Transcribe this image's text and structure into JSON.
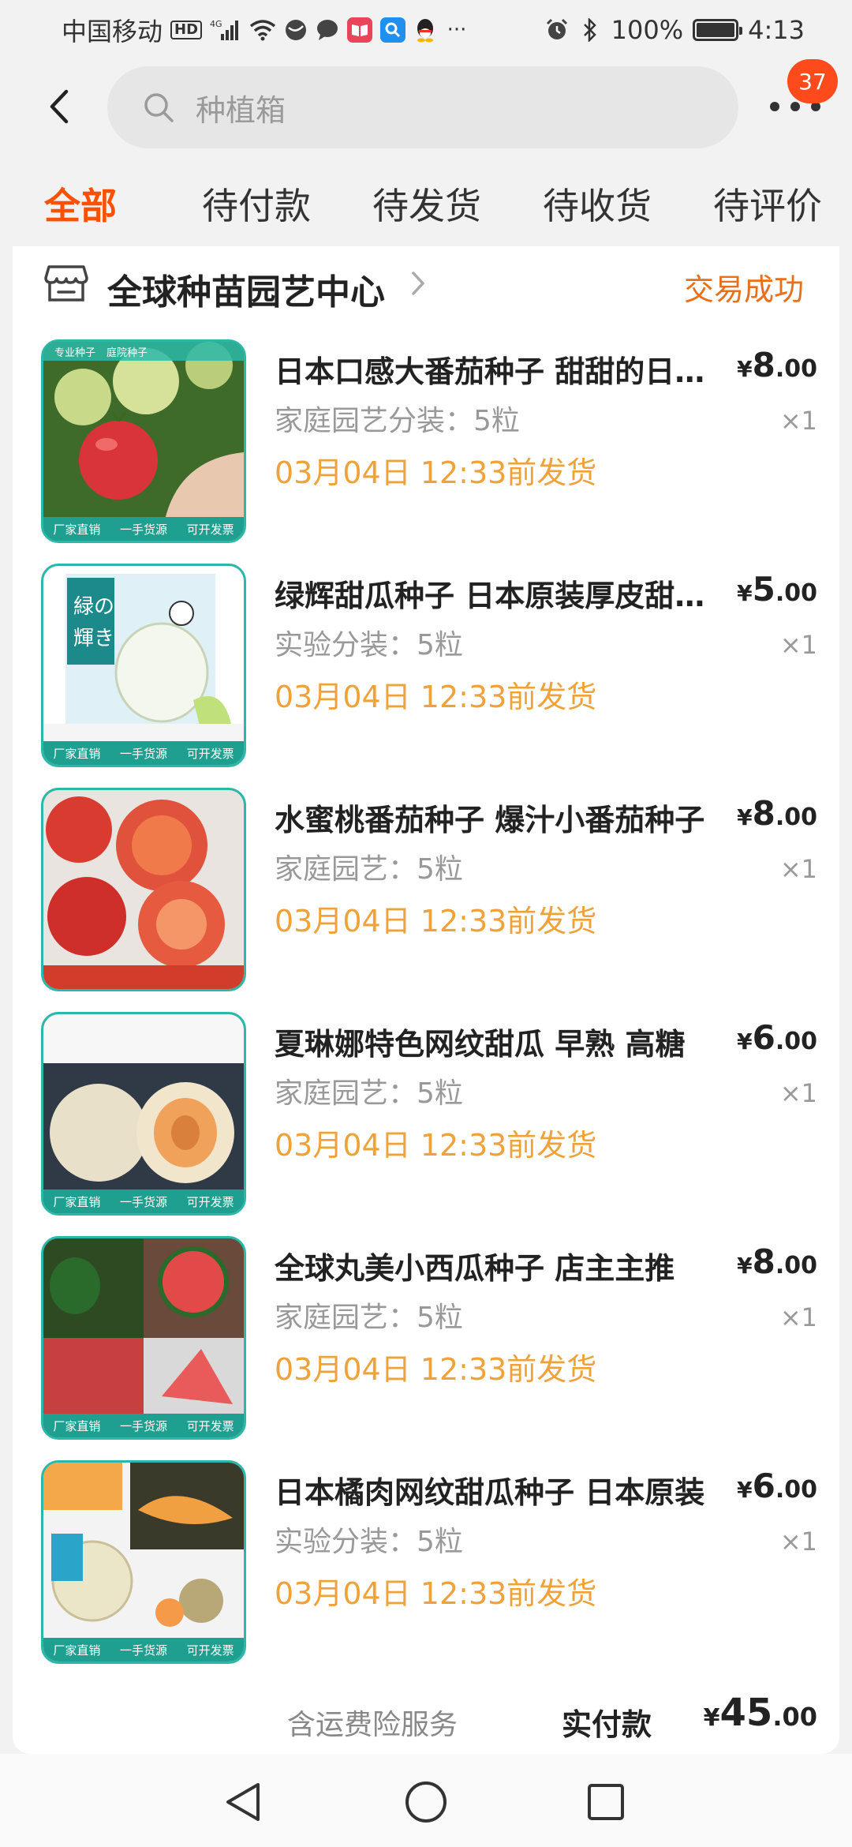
{
  "status_bar": {
    "carrier": "中国移动",
    "hd": "HD",
    "network": "4G",
    "battery": "100%",
    "time": "4:13",
    "icons": [
      "signal-icon",
      "wifi-icon",
      "app-icon",
      "chat-icon",
      "book-icon",
      "search-app-icon",
      "qq-icon",
      "more-dots-icon",
      "alarm-icon",
      "bluetooth-icon",
      "battery-icon"
    ]
  },
  "header": {
    "search_placeholder": "种植箱",
    "notification_count": "37"
  },
  "tabs": [
    "全部",
    "待付款",
    "待发货",
    "待收货",
    "待评价"
  ],
  "active_tab": 0,
  "order": {
    "store_name": "全球种苗园艺中心",
    "status": "交易成功",
    "items": [
      {
        "title": "日本口感大番茄种子  甜甜的日本大番茄",
        "sku": "家庭园艺分装：5粒",
        "ship": "03月04日 12:33前发货",
        "price_currency": "¥",
        "price_int": "8",
        "price_dec": ".00",
        "qty": "×1"
      },
      {
        "title": "绿辉甜瓜种子  日本原装厚皮甜瓜种子",
        "sku": "实验分装：5粒",
        "ship": "03月04日 12:33前发货",
        "price_currency": "¥",
        "price_int": "5",
        "price_dec": ".00",
        "qty": "×1"
      },
      {
        "title": "水蜜桃番茄种子 爆汁小番茄种子",
        "sku": "家庭园艺：5粒",
        "ship": "03月04日 12:33前发货",
        "price_currency": "¥",
        "price_int": "8",
        "price_dec": ".00",
        "qty": "×1"
      },
      {
        "title": "夏琳娜特色网纹甜瓜 早熟 高糖",
        "sku": "家庭园艺：5粒",
        "ship": "03月04日 12:33前发货",
        "price_currency": "¥",
        "price_int": "6",
        "price_dec": ".00",
        "qty": "×1"
      },
      {
        "title": "全球丸美小西瓜种子 店主主推",
        "sku": "家庭园艺：5粒",
        "ship": "03月04日 12:33前发货",
        "price_currency": "¥",
        "price_int": "8",
        "price_dec": ".00",
        "qty": "×1"
      },
      {
        "title": "日本橘肉网纹甜瓜种子 日本原装",
        "sku": "实验分装：5粒",
        "ship": "03月04日 12:33前发货",
        "price_currency": "¥",
        "price_int": "6",
        "price_dec": ".00",
        "qty": "×1"
      }
    ],
    "thumb_tags": [
      "专业种子",
      "庭院种子"
    ],
    "thumb_band": [
      "厂家直销",
      "一手货源",
      "可开发票"
    ],
    "total_note": "含运费险服务",
    "total_label": "实付款",
    "total_currency": "¥",
    "total_int": "45",
    "total_dec": ".00"
  },
  "colors": {
    "accent": "#ff5000",
    "status_orange": "#e8701a",
    "ship_orange": "#f0a23a",
    "badge_red": "#ff4a1c",
    "thumb_teal": "#2bb8a8"
  }
}
